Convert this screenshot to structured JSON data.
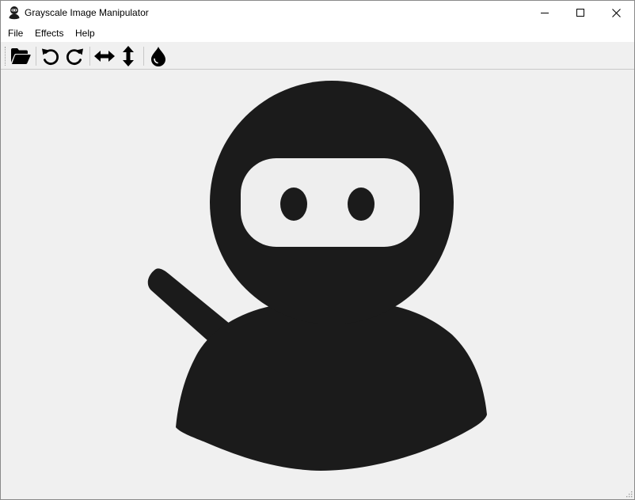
{
  "window": {
    "title": "Grayscale Image Manipulator",
    "app_icon": "ninja-icon"
  },
  "menu": [
    {
      "label": "File"
    },
    {
      "label": "Effects"
    },
    {
      "label": "Help"
    }
  ],
  "toolbar": {
    "buttons": [
      {
        "name": "open-folder-icon"
      },
      {
        "name": "undo-icon"
      },
      {
        "name": "redo-icon"
      },
      {
        "name": "flip-horizontal-icon"
      },
      {
        "name": "flip-vertical-icon"
      },
      {
        "name": "grayscale-drop-icon"
      }
    ]
  },
  "canvas": {
    "image": "ninja-illustration",
    "fill_color": "#1b1b1b",
    "background_color": "#f0f0f0"
  }
}
